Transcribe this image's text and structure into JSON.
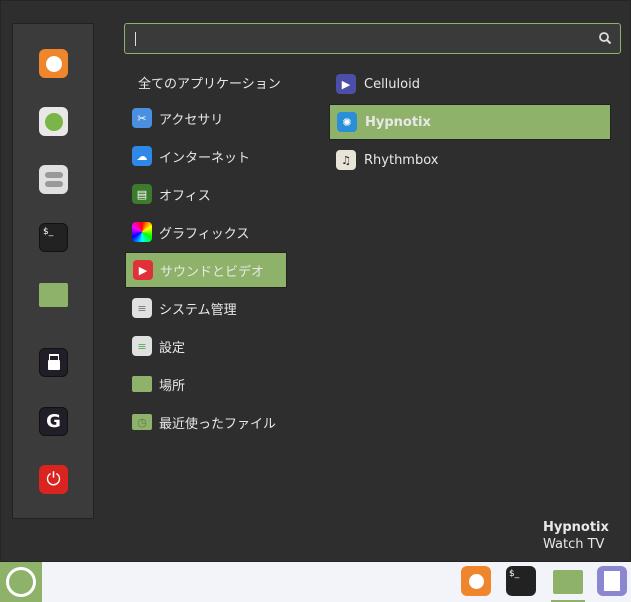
{
  "search": {
    "value": "",
    "placeholder": ""
  },
  "sidebar": {
    "items": [
      {
        "name": "firefox",
        "color": "#f0862b"
      },
      {
        "name": "software-manager",
        "color": "#e8e8e8"
      },
      {
        "name": "system-settings",
        "color": "#e0e0e0"
      },
      {
        "name": "terminal",
        "color": "#222222",
        "label": "$_"
      },
      {
        "name": "files",
        "color": "#8fb26b"
      },
      {
        "name": "lock-screen",
        "color": "#221e28"
      },
      {
        "name": "logout",
        "color": "#221e28"
      },
      {
        "name": "shutdown",
        "color": "#d9241f"
      }
    ]
  },
  "categories": {
    "header": "全てのアプリケーション",
    "items": [
      {
        "label": "アクセサリ",
        "icon": "scissors-icon",
        "color": "#4a8fe0"
      },
      {
        "label": "インターネット",
        "icon": "cloud-icon",
        "color": "#2f87e8"
      },
      {
        "label": "オフィス",
        "icon": "office-icon",
        "color": "#3d7a2e"
      },
      {
        "label": "グラフィックス",
        "icon": "graphics-icon",
        "color": "#a030c0"
      },
      {
        "label": "サウンドとビデオ",
        "icon": "play-icon",
        "color": "#e0303a",
        "selected": true
      },
      {
        "label": "システム管理",
        "icon": "toggle-icon",
        "color": "#e0e0e0"
      },
      {
        "label": "設定",
        "icon": "settings-icon",
        "color": "#e0e0e0"
      },
      {
        "label": "場所",
        "icon": "folder-icon",
        "color": "#8fb26b"
      },
      {
        "label": "最近使ったファイル",
        "icon": "recent-folder-icon",
        "color": "#8fb26b"
      }
    ]
  },
  "apps": [
    {
      "label": "Celluloid",
      "icon": "celluloid-icon",
      "color": "#4b4fa8"
    },
    {
      "label": "Hypnotix",
      "icon": "hypnotix-icon",
      "color": "#2a8fd8",
      "selected": true
    },
    {
      "label": "Rhythmbox",
      "icon": "rhythmbox-icon",
      "color": "#e8e4d8"
    }
  ],
  "description": {
    "title": "Hypnotix",
    "subtitle": "Watch TV"
  },
  "taskbar": {
    "terminal_label": "$_"
  }
}
